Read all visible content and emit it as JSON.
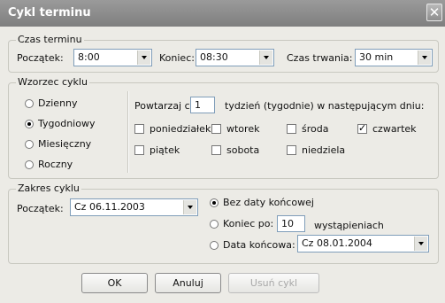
{
  "window": {
    "title": "Cykl terminu",
    "close_glyph": "✕"
  },
  "czas_terminu": {
    "legend": "Czas terminu",
    "start_label": "Początek:",
    "start_value": "8:00",
    "end_label": "Koniec:",
    "end_value": "08:30",
    "duration_label": "Czas trwania:",
    "duration_value": "30 min"
  },
  "wzorzec": {
    "legend": "Wzorzec cyklu",
    "options": [
      {
        "label": "Dzienny",
        "selected": false
      },
      {
        "label": "Tygodniowy",
        "selected": true
      },
      {
        "label": "Miesięczny",
        "selected": false
      },
      {
        "label": "Roczny",
        "selected": false
      }
    ],
    "repeat_prefix": "Powtarzaj co",
    "repeat_value": "1",
    "repeat_suffix": "tydzień (tygodnie) w następującym dniu:",
    "days": [
      {
        "label": "poniedziałek",
        "checked": false
      },
      {
        "label": "wtorek",
        "checked": false
      },
      {
        "label": "środa",
        "checked": false
      },
      {
        "label": "czwartek",
        "checked": true
      },
      {
        "label": "piątek",
        "checked": false
      },
      {
        "label": "sobota",
        "checked": false
      },
      {
        "label": "niedziela",
        "checked": false
      }
    ]
  },
  "zakres": {
    "legend": "Zakres cyklu",
    "start_label": "Początek:",
    "start_value": "Cz 06.11.2003",
    "no_end_label": "Bez daty końcowej",
    "end_after_label": "Koniec po:",
    "end_after_value": "10",
    "occurrences_label": "wystąpieniach",
    "end_date_label": "Data końcowa:",
    "end_date_value": "Cz 08.01.2004",
    "selected": "no_end"
  },
  "buttons": {
    "ok": "OK",
    "cancel": "Anuluj",
    "remove": "Usuń cykl"
  },
  "colors": {
    "titlebar": "#8a8a8a",
    "dialog_bg": "#ecebe6",
    "field_border": "#7f9db9"
  }
}
